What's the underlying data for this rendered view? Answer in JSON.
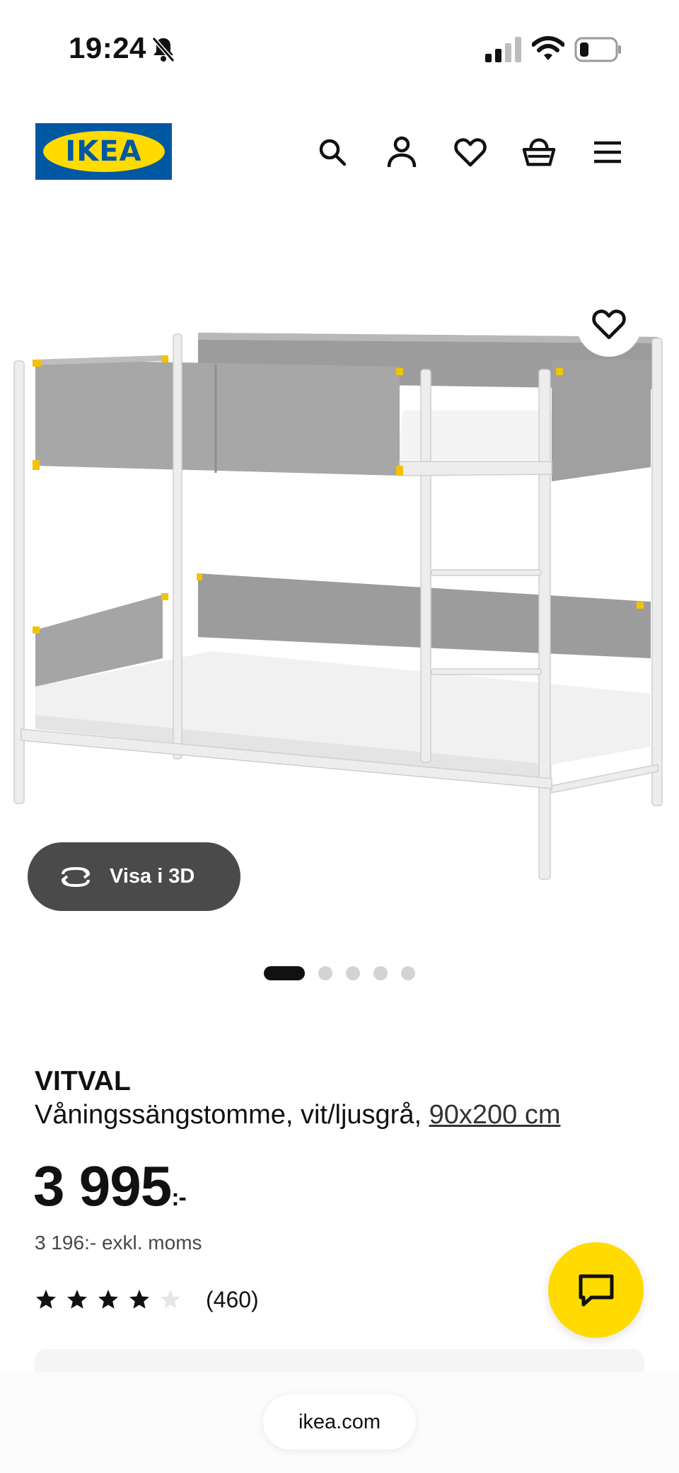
{
  "status_bar": {
    "time": "19:24",
    "icons": [
      "bell-muted-icon",
      "signal-icon",
      "wifi-icon",
      "battery-icon"
    ]
  },
  "header": {
    "logo_text": "IKEA",
    "icons": [
      "search-icon",
      "account-icon",
      "heart-icon",
      "basket-icon",
      "menu-icon"
    ]
  },
  "gallery": {
    "view_3d_label": "Visa i 3D",
    "image_count": 5,
    "active_index": 0
  },
  "product": {
    "brand": "VITVAL",
    "description": "Våningssängstomme, vit/ljusgrå,",
    "size_link": "90x200 cm",
    "price_main": "3 995",
    "price_suffix": ":-",
    "price_excl_vat": "3 196:- exkl. moms",
    "rating": {
      "value": 4,
      "max": 5
    },
    "review_count": "(460)"
  },
  "browser": {
    "url": "ikea.com"
  },
  "colors": {
    "ikea_blue": "#0058a3",
    "ikea_yellow": "#ffdb00",
    "button_dark": "#4a4a4a"
  }
}
